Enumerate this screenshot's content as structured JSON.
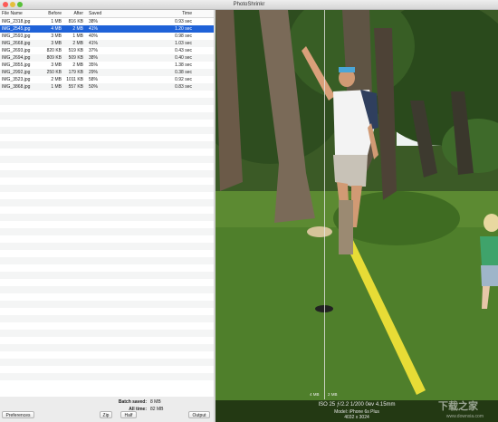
{
  "window": {
    "title": "PhotoShrinkr"
  },
  "table": {
    "columns": [
      "File Name",
      "Before",
      "After",
      "Saved",
      "Time"
    ],
    "rows": [
      {
        "name": "IMG_2318.jpg",
        "before": "1 MB",
        "after": "816 KB",
        "saved": "38%",
        "time": "0.93 sec"
      },
      {
        "name": "IMG_2545.jpg",
        "before": "4 MB",
        "after": "2 MB",
        "saved": "41%",
        "time": "1.20 sec"
      },
      {
        "name": "IMG_2593.jpg",
        "before": "3 MB",
        "after": "1 MB",
        "saved": "40%",
        "time": "0.98 sec"
      },
      {
        "name": "IMG_2668.jpg",
        "before": "3 MB",
        "after": "2 MB",
        "saved": "41%",
        "time": "1.03 sec"
      },
      {
        "name": "IMG_2693.jpg",
        "before": "820 KB",
        "after": "519 KB",
        "saved": "37%",
        "time": "0.43 sec"
      },
      {
        "name": "IMG_2694.jpg",
        "before": "809 KB",
        "after": "509 KB",
        "saved": "38%",
        "time": "0.40 sec"
      },
      {
        "name": "IMG_2855.jpg",
        "before": "3 MB",
        "after": "2 MB",
        "saved": "35%",
        "time": "1.38 sec"
      },
      {
        "name": "IMG_2992.jpg",
        "before": "250 KB",
        "after": "179 KB",
        "saved": "29%",
        "time": "0.38 sec"
      },
      {
        "name": "IMG_3523.jpg",
        "before": "2 MB",
        "after": "1011 KB",
        "saved": "58%",
        "time": "0.92 sec"
      },
      {
        "name": "IMG_3868.jpg",
        "before": "1 MB",
        "after": "557 KB",
        "saved": "50%",
        "time": "0.83 sec"
      }
    ],
    "selected_index": 1
  },
  "summary": {
    "batch_label": "Batch saved:",
    "batch_value": "8 MB",
    "alltime_label": "All time:",
    "alltime_value": "82 MB"
  },
  "buttons": {
    "preferences": "Preferences",
    "zip": "Zip",
    "half": "Half",
    "output": "Output"
  },
  "preview": {
    "before_size": "4 MB",
    "after_size": "2 MB",
    "exif_line": "ISO 25  ƒ/2.2  1/200  0ev  4.15mm",
    "model_line": "Model: iPhone 6s Plus",
    "resolution_line": "4032 x 3024",
    "watermark": "下载之家",
    "watermark_url": "www.downxia.com"
  },
  "colors": {
    "selection": "#1f62d8",
    "grass": "#4d7a2c",
    "sky": "#f2f5f3"
  }
}
